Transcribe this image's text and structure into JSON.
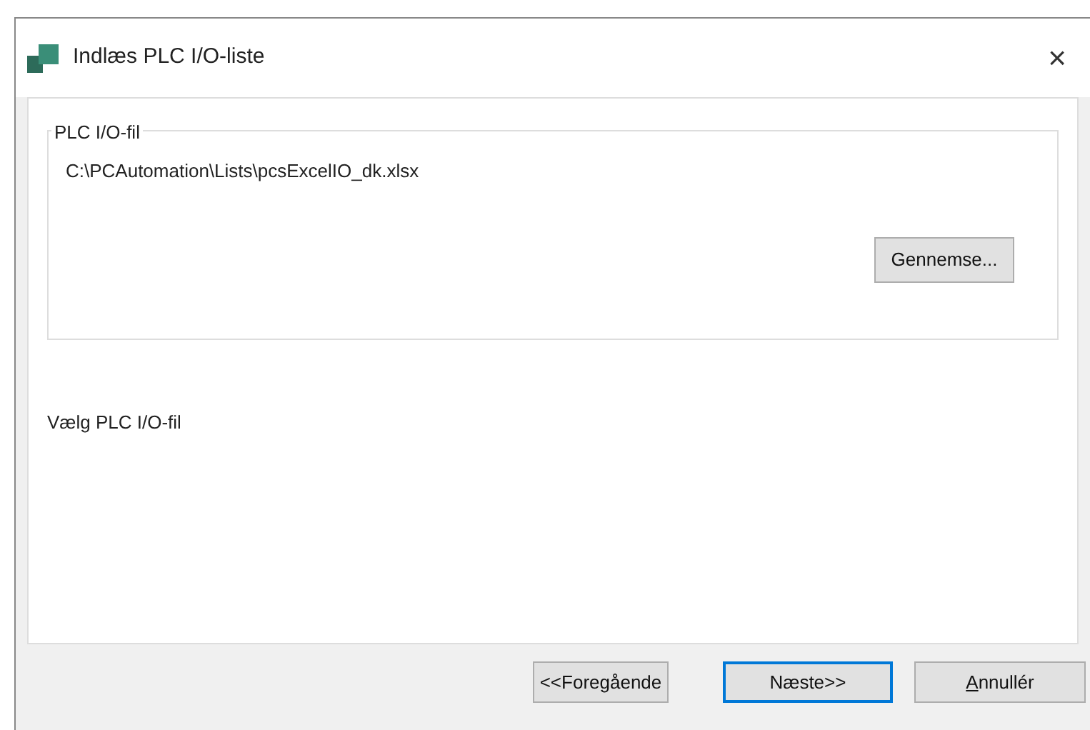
{
  "window": {
    "title": "Indlæs PLC I/O-liste",
    "close": "×"
  },
  "group": {
    "legend": "PLC I/O-fil",
    "path": "C:\\PCAutomation\\Lists\\pcsExcelIO_dk.xlsx",
    "browse_button": "Gennemse..."
  },
  "status_text": "Vælg PLC I/O-fil",
  "buttons": [
    {
      "label": "<<Foregående",
      "focused": false
    },
    {
      "label": "Næste>>",
      "focused": true
    },
    {
      "label": "Annullér",
      "focused": false
    }
  ]
}
